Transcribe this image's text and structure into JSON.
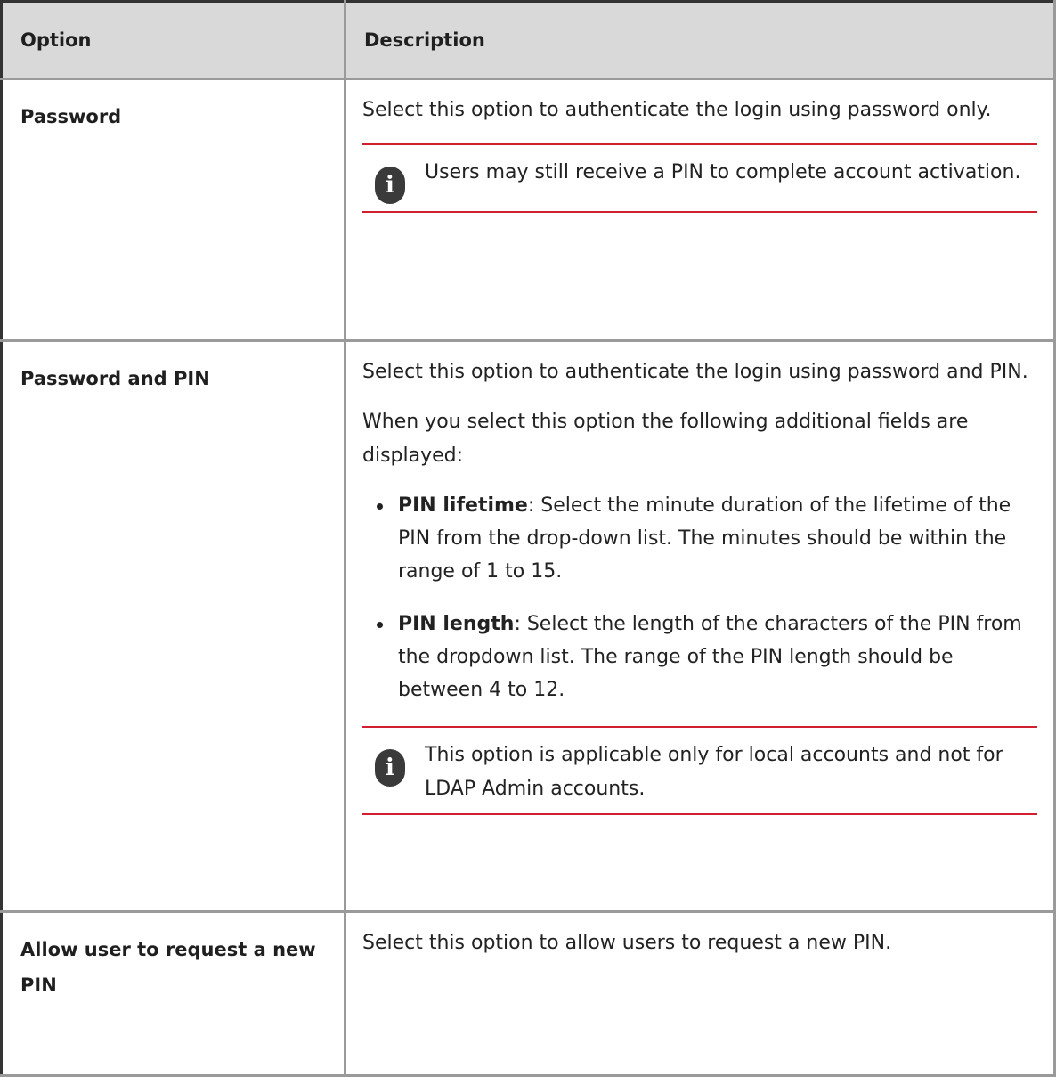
{
  "table": {
    "headers": {
      "option": "Option",
      "description": "Description"
    },
    "rows": [
      {
        "option": "Password",
        "paragraphs": [
          "Select this option to authenticate the login using password only."
        ],
        "note": "Users may still receive a PIN to complete account activation."
      },
      {
        "option": "Password and PIN",
        "paragraphs": [
          "Select this option to authenticate the login using password and PIN.",
          "When you select this option the following additional fields are displayed:"
        ],
        "bullets": [
          {
            "term": "PIN lifetime",
            "text": ": Select the minute duration of the lifetime of the PIN from the drop-down list. The minutes should be within the range of 1 to 15."
          },
          {
            "term": "PIN length",
            "text": ": Select the length of the characters of the PIN from the dropdown list. The range of the PIN length should be between 4 to 12."
          }
        ],
        "note": "This option is applicable only for local accounts and not for LDAP Admin accounts."
      },
      {
        "option": "Allow user to request a new PIN",
        "paragraphs": [
          "Select this option to allow users to request a new PIN."
        ]
      }
    ]
  },
  "icons": {
    "note_icon": "info-icon",
    "note_icon_glyph": "i",
    "note_rule_color": "#d01f2e",
    "header_background": "#d9d9d9"
  }
}
